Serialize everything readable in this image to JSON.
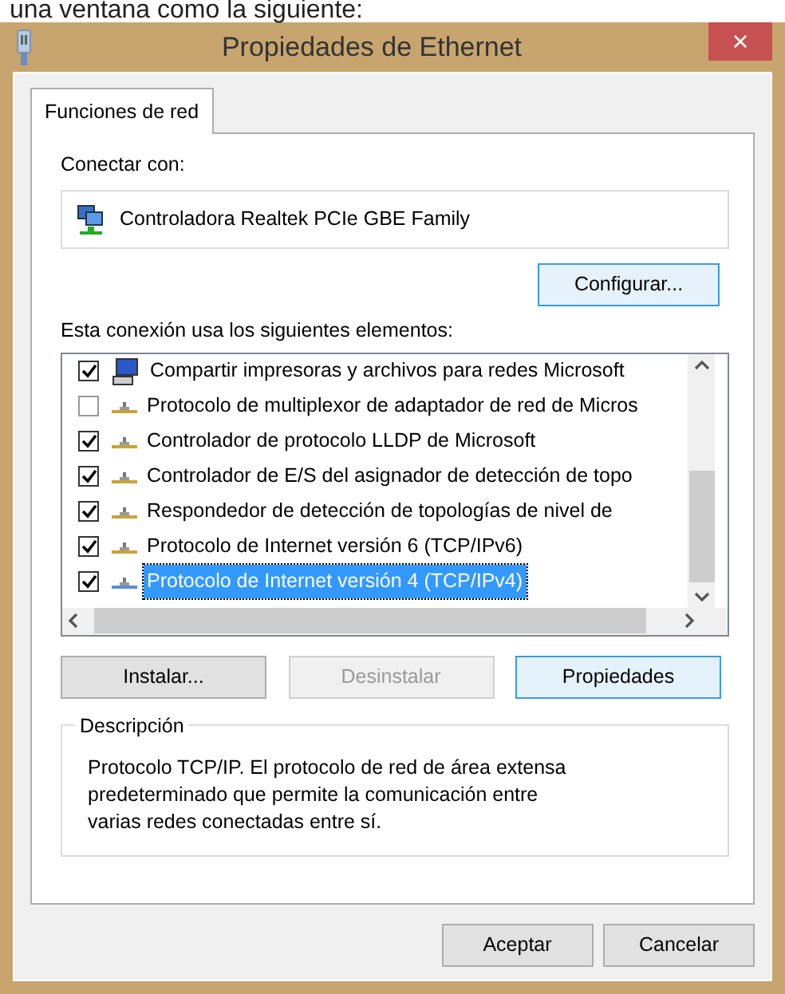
{
  "caption": "una ventana como la siguiente:",
  "window": {
    "title": "Propiedades de Ethernet",
    "close": "×"
  },
  "tabs": [
    {
      "label": "Funciones de red",
      "selected": true
    }
  ],
  "connect": {
    "label": "Conectar con:",
    "adapter": "Controladora Realtek PCIe GBE Family",
    "button": {
      "label": "Configurar...",
      "highlighted": true,
      "disabled": false
    }
  },
  "items_label": "Esta conexión usa los siguientes elementos:",
  "items": [
    {
      "kind": "service",
      "label": "Compartir impresoras y archivos para redes Microsoft",
      "checked": true,
      "selected": false
    },
    {
      "kind": "protocol",
      "label": "Protocolo de multiplexor de adaptador de red de Micros",
      "checked": false,
      "selected": false
    },
    {
      "kind": "protocol",
      "label": "Controlador de protocolo LLDP de Microsoft",
      "checked": true,
      "selected": false
    },
    {
      "kind": "protocol",
      "label": "Controlador de E/S del asignador de detección de topo",
      "checked": true,
      "selected": false
    },
    {
      "kind": "protocol",
      "label": "Respondedor de detección de topologías de nivel de",
      "checked": true,
      "selected": false
    },
    {
      "kind": "protocol",
      "label": "Protocolo de Internet versión 6 (TCP/IPv6)",
      "checked": true,
      "selected": false
    },
    {
      "kind": "protocol",
      "label": "Protocolo de Internet versión 4 (TCP/IPv4)",
      "checked": true,
      "selected": true
    }
  ],
  "item_buttons": [
    {
      "label": "Instalar...",
      "disabled": false,
      "highlighted": false
    },
    {
      "label": "Desinstalar",
      "disabled": true,
      "highlighted": false
    },
    {
      "label": "Propiedades",
      "disabled": false,
      "highlighted": true
    }
  ],
  "description": {
    "legend": "Descripción",
    "text": "Protocolo TCP/IP. El protocolo de red de área extensa predeterminado que permite la comunicación entre varias redes conectadas entre sí."
  },
  "footer_buttons": [
    {
      "label": "Aceptar",
      "disabled": false,
      "highlighted": false
    },
    {
      "label": "Cancelar",
      "disabled": false,
      "highlighted": false
    }
  ]
}
